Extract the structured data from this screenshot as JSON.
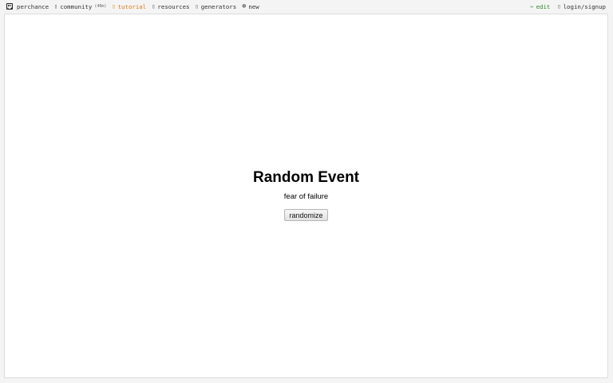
{
  "topbar": {
    "left": [
      {
        "id": "perchance",
        "label": "perchance",
        "icon": "dice-icon"
      },
      {
        "id": "community",
        "label": "community",
        "badge": "(40m)",
        "icon": "chat-icon"
      },
      {
        "id": "tutorial",
        "label": "tutorial",
        "icon": "book-icon"
      },
      {
        "id": "resources",
        "label": "resources",
        "icon": "book-icon"
      },
      {
        "id": "generators",
        "label": "generators",
        "icon": "list-icon"
      },
      {
        "id": "new",
        "label": "new",
        "icon": "plus-circle-icon"
      }
    ],
    "right": [
      {
        "id": "edit",
        "label": "edit",
        "icon": "pencil-icon"
      },
      {
        "id": "login",
        "label": "login/signup",
        "icon": "user-icon"
      }
    ]
  },
  "main": {
    "title": "Random Event",
    "result": "fear of failure",
    "button_label": "randomize"
  },
  "colors": {
    "tutorial": "#e07b15",
    "edit": "#2a8a2a"
  }
}
